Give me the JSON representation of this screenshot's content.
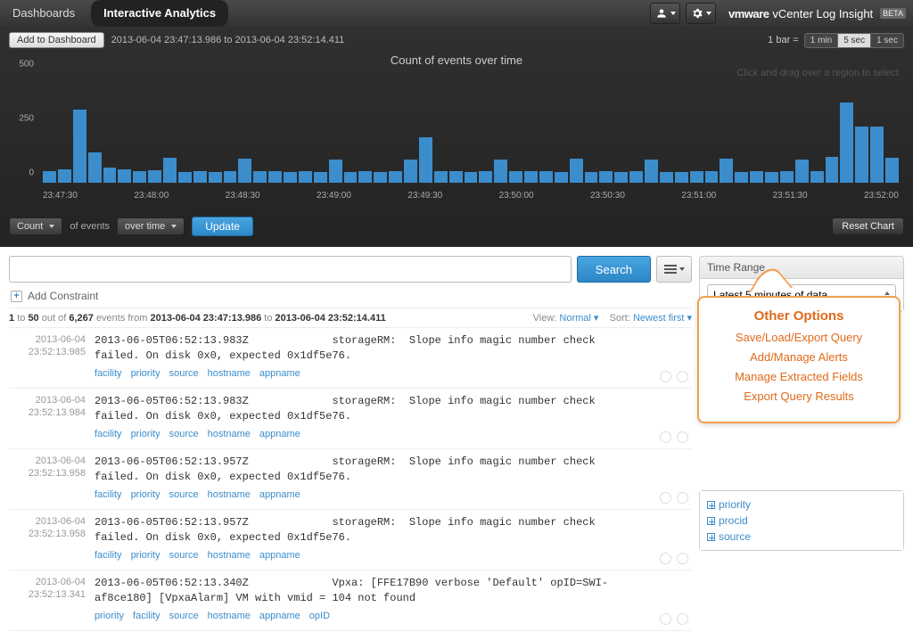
{
  "nav": {
    "dashboards": "Dashboards",
    "interactive": "Interactive Analytics",
    "brand_vm": "vmware",
    "brand_rest": "vCenter Log Insight",
    "beta": "BETA"
  },
  "chart_toolbar": {
    "add_to_dashboard": "Add to Dashboard",
    "time_range": "2013-06-04 23:47:13.986 to 2013-06-04 23:52:14.411",
    "bar_equals": "1 bar =",
    "bar_opts": {
      "a": "1 min",
      "b": "5 sec",
      "c": "1 sec"
    },
    "bar_active": "b",
    "title": "Count of events over time",
    "drag_hint": "Click and drag over a region to select"
  },
  "chart_data": {
    "type": "bar",
    "ylabel": "",
    "xlabel": "",
    "ylim": [
      0,
      500
    ],
    "yticks": [
      0,
      250,
      500
    ],
    "xticks": [
      "23:47:30",
      "23:48:00",
      "23:48:30",
      "23:49:00",
      "23:49:30",
      "23:50:00",
      "23:50:30",
      "23:51:00",
      "23:51:30",
      "23:52:00"
    ],
    "values": [
      55,
      60,
      335,
      140,
      70,
      60,
      55,
      58,
      115,
      50,
      55,
      50,
      55,
      110,
      55,
      55,
      50,
      55,
      50,
      105,
      50,
      55,
      50,
      52,
      108,
      210,
      55,
      55,
      50,
      55,
      105,
      55,
      55,
      52,
      50,
      110,
      50,
      55,
      50,
      55,
      105,
      50,
      50,
      55,
      52,
      110,
      50,
      55,
      50,
      55,
      105,
      55,
      120,
      370,
      260,
      260,
      115
    ]
  },
  "controls": {
    "count": "Count",
    "of_events": "of events",
    "over_time": "over time",
    "update": "Update",
    "reset": "Reset Chart"
  },
  "search": {
    "placeholder": "",
    "button": "Search",
    "add_constraint": "Add Constraint"
  },
  "results_meta": {
    "prefix1": "1",
    "to": "to",
    "prefix2": "50",
    "outof": "out of",
    "total": "6,267",
    "events_from": "events from",
    "range_start": "2013-06-04 23:47:13.986",
    "range_to": "to",
    "range_end": "2013-06-04 23:52:14.411",
    "view_label": "View:",
    "view_value": "Normal",
    "sort_label": "Sort:",
    "sort_value": "Newest first"
  },
  "events": [
    {
      "date": "2013-06-04",
      "time": "23:52:13.985",
      "text": "2013-06-05T06:52:13.983Z             storageRM:  Slope info magic number check\nfailed. On disk 0x0, expected 0x1df5e76.",
      "tags": [
        "facility",
        "priority",
        "source",
        "hostname",
        "appname"
      ]
    },
    {
      "date": "2013-06-04",
      "time": "23:52:13.984",
      "text": "2013-06-05T06:52:13.983Z             storageRM:  Slope info magic number check\nfailed. On disk 0x0, expected 0x1df5e76.",
      "tags": [
        "facility",
        "priority",
        "source",
        "hostname",
        "appname"
      ]
    },
    {
      "date": "2013-06-04",
      "time": "23:52:13.958",
      "text": "2013-06-05T06:52:13.957Z             storageRM:  Slope info magic number check\nfailed. On disk 0x0, expected 0x1df5e76.",
      "tags": [
        "facility",
        "priority",
        "source",
        "hostname",
        "appname"
      ]
    },
    {
      "date": "2013-06-04",
      "time": "23:52:13.958",
      "text": "2013-06-05T06:52:13.957Z             storageRM:  Slope info magic number check\nfailed. On disk 0x0, expected 0x1df5e76.",
      "tags": [
        "facility",
        "priority",
        "source",
        "hostname",
        "appname"
      ]
    },
    {
      "date": "2013-06-04",
      "time": "23:52:13.341",
      "text": "2013-06-05T06:52:13.340Z             Vpxa: [FFE17B90 verbose 'Default' opID=SWI-\naf8ce180] [VpxaAlarm] VM with vmid = 104 not found",
      "tags": [
        "priority",
        "facility",
        "source",
        "hostname",
        "appname",
        "opID"
      ]
    }
  ],
  "sidebar": {
    "time_range_header": "Time Range",
    "time_range_value": "Latest 5 minutes of data",
    "fields": [
      "priority",
      "procid",
      "source"
    ]
  },
  "callout": {
    "title": "Other Options",
    "l1": "Save/Load/Export Query",
    "l2": "Add/Manage Alerts",
    "l3": "Manage Extracted Fields",
    "l4": "Export Query Results"
  }
}
